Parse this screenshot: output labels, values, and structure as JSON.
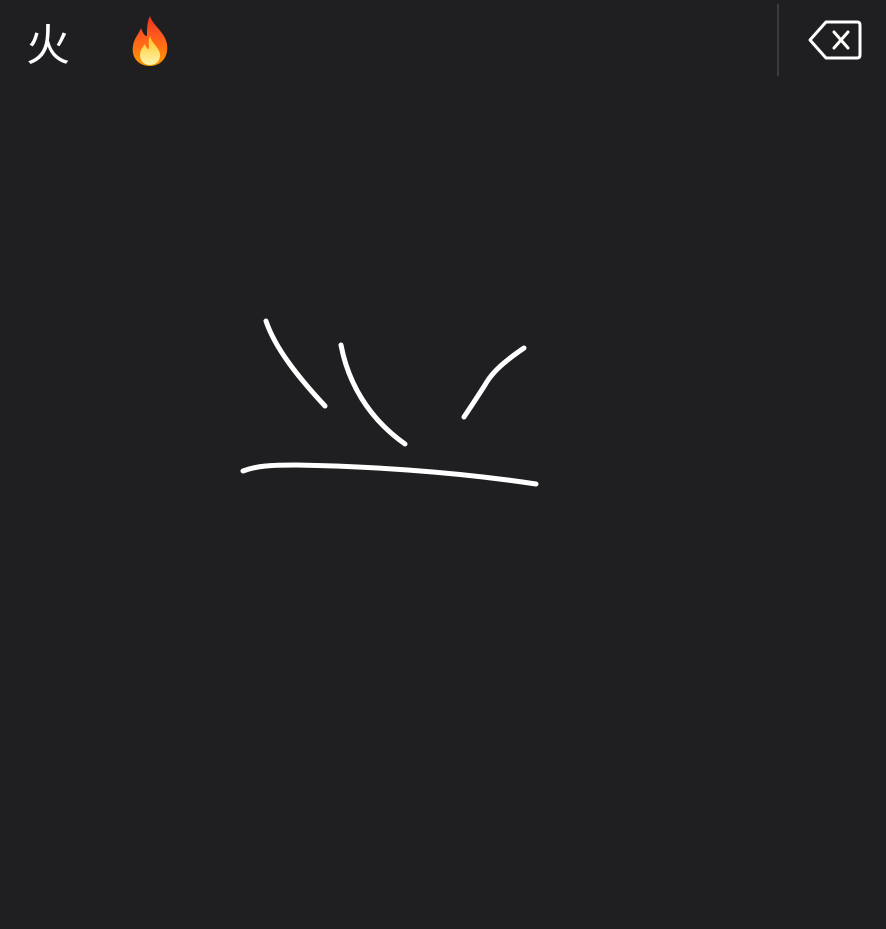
{
  "candidates": [
    {
      "text": "火",
      "kind": "character"
    },
    {
      "text": "🔥",
      "kind": "emoji",
      "icon": "fire-icon"
    }
  ],
  "delete_button": {
    "icon": "backspace-icon"
  },
  "colors": {
    "background": "#1f1e21",
    "stroke": "#ffffff",
    "divider": "#3b3a3e"
  }
}
